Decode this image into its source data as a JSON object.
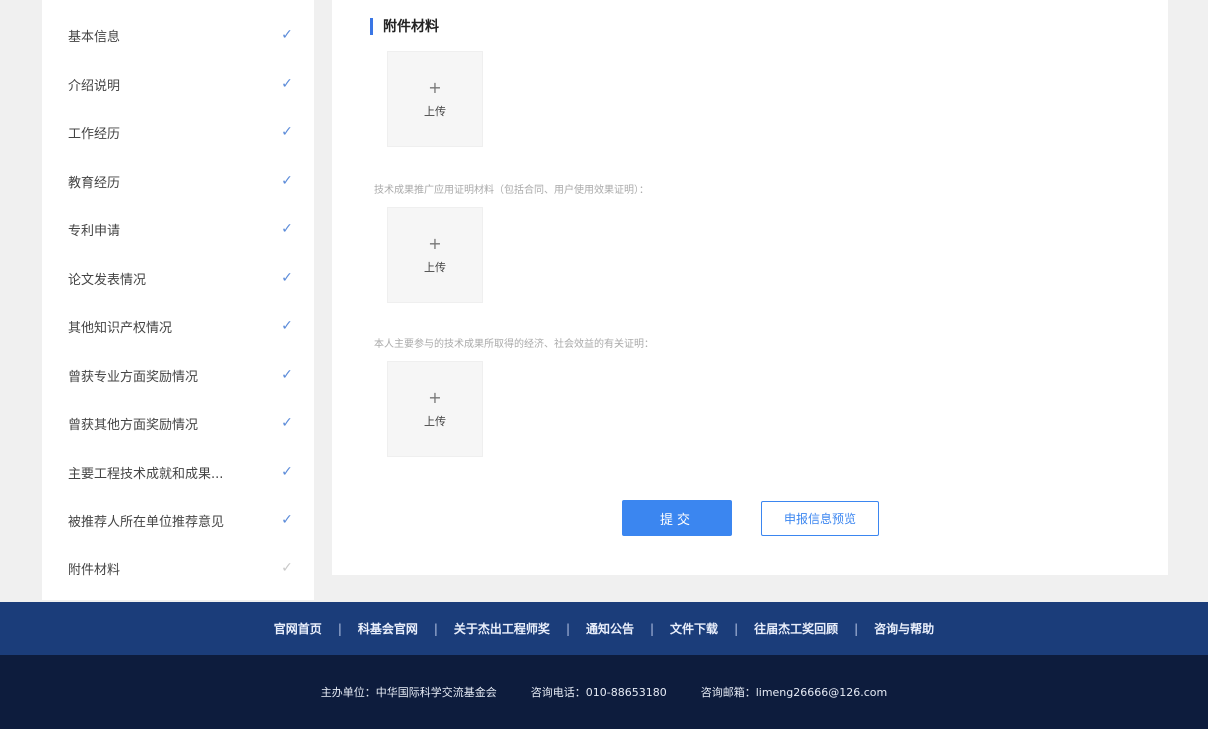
{
  "sidebar": {
    "items": [
      {
        "label": "基本信息",
        "done": true
      },
      {
        "label": "介绍说明",
        "done": true
      },
      {
        "label": "工作经历",
        "done": true
      },
      {
        "label": "教育经历",
        "done": true
      },
      {
        "label": "专利申请",
        "done": true
      },
      {
        "label": "论文发表情况",
        "done": true
      },
      {
        "label": "其他知识产权情况",
        "done": true
      },
      {
        "label": "曾获专业方面奖励情况",
        "done": true
      },
      {
        "label": "曾获其他方面奖励情况",
        "done": true
      },
      {
        "label": "主要工程技术成就和成果...",
        "done": true
      },
      {
        "label": "被推荐人所在单位推荐意见",
        "done": true
      },
      {
        "label": "附件材料",
        "done": false
      }
    ],
    "check_glyph": "✓",
    "check_icon": "checkmark-icon"
  },
  "main": {
    "section_title": "附件材料",
    "uploads": [
      {
        "label": "",
        "plus": "+",
        "button_label": "上传"
      },
      {
        "label": "技术成果推广应用证明材料（包括合同、用户使用效果证明）：",
        "plus": "+",
        "button_label": "上传"
      },
      {
        "label": "本人主要参与的技术成果所取得的经济、社会效益的有关证明：",
        "plus": "+",
        "button_label": "上传"
      }
    ],
    "submit_label": "提交",
    "preview_label": "申报信息预览"
  },
  "footer": {
    "nav": [
      "官网首页",
      "科基会官网",
      "关于杰出工程师奖",
      "通知公告",
      "文件下载",
      "往届杰工奖回顾",
      "咨询与帮助"
    ],
    "separator": "|",
    "organizer": "主办单位：中华国际科学交流基金会",
    "phone": "咨询电话：010-88653180",
    "email": "咨询邮箱：limeng26666@126.com"
  },
  "colors": {
    "accent": "#3b86f0",
    "check_done": "#5b8bd9",
    "check_pending": "#c9c9c9",
    "footer_nav_bg": "#1b3d7a",
    "footer_info_bg": "#0d1c3d"
  }
}
